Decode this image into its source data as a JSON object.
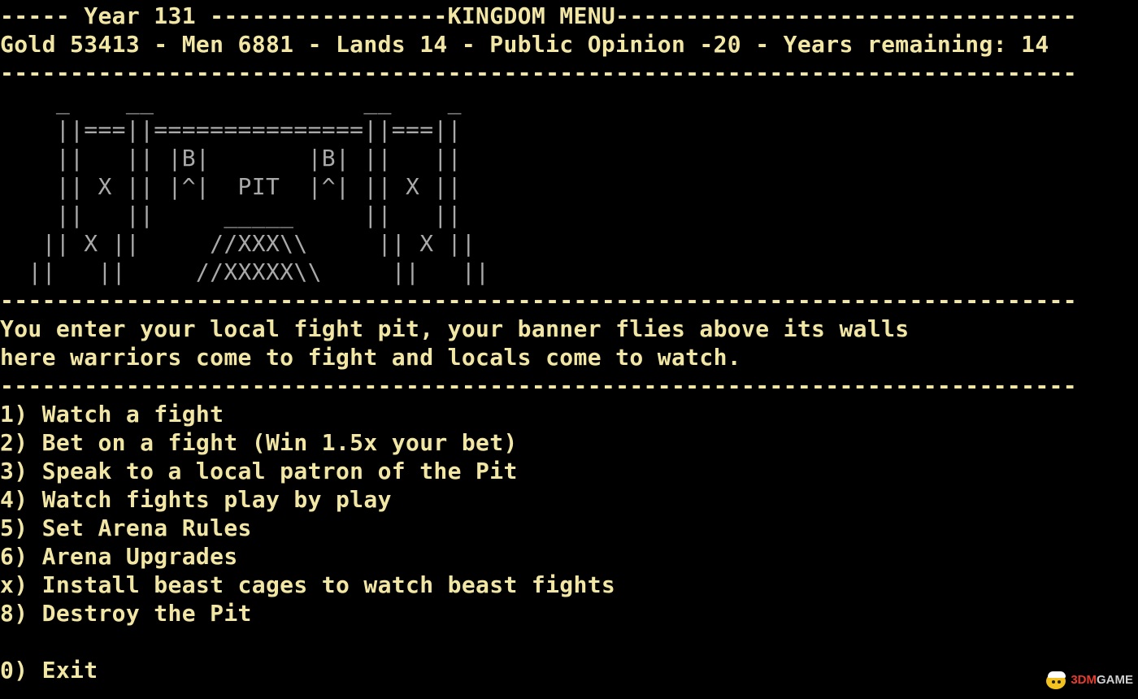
{
  "header": {
    "title_line": "----- Year 131 -----------------KINGDOM MENU---------------------------------",
    "stats_line": "Gold 53413 - Men 6881 - Lands 14 - Public Opinion -20 - Years remaining: 14",
    "divider": "-----------------------------------------------------------------------------"
  },
  "art": {
    "lines": [
      "    _    __               __    _",
      "    ||===||===============||===||",
      "    ||   || |B|       |B| ||   ||",
      "    || X || |^|  PIT  |^| || X ||",
      "    ||   ||     _____     ||   ||",
      "   || X ||     //XXX\\\\     || X ||",
      "  ||   ||     //XXXXX\\\\     ||   ||"
    ]
  },
  "description": {
    "divider_top": "-----------------------------------------------------------------------------",
    "lines": [
      "You enter your local fight pit, your banner flies above its walls",
      "here warriors come to fight and locals come to watch."
    ],
    "divider_bottom": "-----------------------------------------------------------------------------"
  },
  "menu": {
    "options": [
      "1) Watch a fight",
      "2) Bet on a fight (Win 1.5x your bet)",
      "3) Speak to a local patron of the Pit",
      "4) Watch fights play by play",
      "5) Set Arena Rules",
      "6) Arena Upgrades",
      "x) Install beast cages to watch beast fights",
      "8) Destroy the Pit"
    ],
    "exit": "0) Exit"
  },
  "watermark": {
    "prefix": "3DM",
    "suffix": "GAME"
  },
  "colors": {
    "background": "#000000",
    "text": "#f2e6a4",
    "art": "#a9a9a9"
  }
}
